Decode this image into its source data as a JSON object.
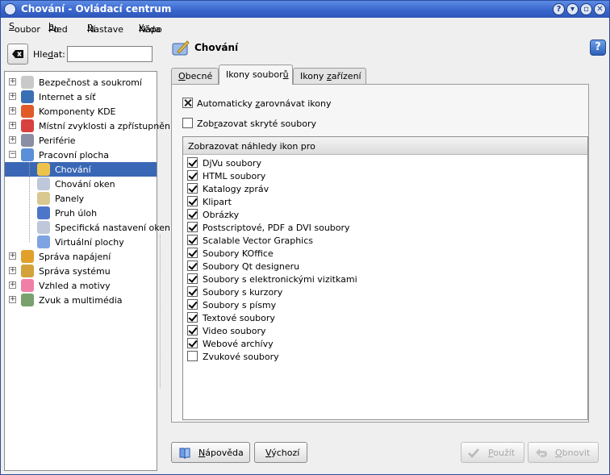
{
  "window": {
    "title": "Chování - Ovládací centrum"
  },
  "titlebar_buttons": [
    "?",
    "▾",
    "▫",
    "✕"
  ],
  "menu": [
    {
      "pre": "",
      "key": "S",
      "post": "oubor"
    },
    {
      "pre": "Po",
      "key": "h",
      "post": "led"
    },
    {
      "pre": "Nastave",
      "key": "n",
      "post": "í"
    },
    {
      "pre": "Nápo",
      "key": "v",
      "post": "ěda"
    }
  ],
  "search": {
    "label_pre": "Hle",
    "label_key": "d",
    "label_post": "at:",
    "value": "",
    "icon": "clear-search-icon"
  },
  "tree": [
    {
      "label": "Bezpečnost a soukromí",
      "icon": "security-icon",
      "color": "#c9c9c9",
      "expander": "+"
    },
    {
      "label": "Internet a síť",
      "icon": "globe-icon",
      "color": "#3a6fb6",
      "expander": "+"
    },
    {
      "label": "Komponenty KDE",
      "icon": "components-icon",
      "color": "#e05a2a",
      "expander": "+"
    },
    {
      "label": "Místní zvyklosti a zpřístupnění",
      "icon": "flag-icon",
      "color": "#d8413f",
      "expander": "+"
    },
    {
      "label": "Periférie",
      "icon": "mouse-icon",
      "color": "#8b8fa3",
      "expander": "+"
    },
    {
      "label": "Pracovní plocha",
      "icon": "desktop-icon",
      "color": "#5b8fd8",
      "expander": "−"
    },
    {
      "label": "Chování",
      "icon": "behavior-icon",
      "color": "#eec34b",
      "child": true,
      "selected": true
    },
    {
      "label": "Chování oken",
      "icon": "window-behavior-icon",
      "color": "#bfc8da",
      "child": true
    },
    {
      "label": "Panely",
      "icon": "panels-icon",
      "color": "#d9c890",
      "child": true
    },
    {
      "label": "Pruh úloh",
      "icon": "taskbar-icon",
      "color": "#4c77c9",
      "child": true
    },
    {
      "label": "Specifická nastavení oken",
      "icon": "window-specific-icon",
      "color": "#bfc8da",
      "child": true
    },
    {
      "label": "Virtuální plochy",
      "icon": "virtual-desktops-icon",
      "color": "#7da3e3",
      "child": true
    },
    {
      "label": "Správa napájení",
      "icon": "power-icon",
      "color": "#e0a02a",
      "expander": "+"
    },
    {
      "label": "Správa systému",
      "icon": "system-icon",
      "color": "#d4a23b",
      "expander": "+"
    },
    {
      "label": "Vzhled a motivy",
      "icon": "appearance-icon",
      "color": "#f07fa8",
      "expander": "+"
    },
    {
      "label": "Zvuk a multimédia",
      "icon": "sound-icon",
      "color": "#7aa06d",
      "expander": "+"
    }
  ],
  "page": {
    "title": "Chování",
    "help": "?"
  },
  "tabs": [
    {
      "pre": "",
      "key": "O",
      "post": "becné",
      "active": false
    },
    {
      "pre": "Ikony soubor",
      "key": "ů",
      "post": "",
      "active": true
    },
    {
      "pre": "Ikony ",
      "key": "z",
      "post": "ařízení",
      "active": false
    }
  ],
  "options": [
    {
      "pre": "Automaticky ",
      "key": "z",
      "post": "arovnávat ikony",
      "state": "x"
    },
    {
      "pre": "Zob",
      "key": "r",
      "post": "azovat skryté soubory",
      "state": "none"
    }
  ],
  "preview_list": {
    "header": "Zobrazovat náhledy ikon pro",
    "items": [
      {
        "label": "DjVu soubory",
        "checked": true
      },
      {
        "label": "HTML soubory",
        "checked": true
      },
      {
        "label": "Katalogy zpráv",
        "checked": true
      },
      {
        "label": "Klipart",
        "checked": true
      },
      {
        "label": "Obrázky",
        "checked": true
      },
      {
        "label": "Postscriptové, PDF a DVI soubory",
        "checked": true
      },
      {
        "label": "Scalable Vector Graphics",
        "checked": true
      },
      {
        "label": "Soubory KOffice",
        "checked": true
      },
      {
        "label": "Soubory Qt designeru",
        "checked": true
      },
      {
        "label": "Soubory s elektronickými vizitkami",
        "checked": true
      },
      {
        "label": "Soubory s kurzory",
        "checked": true
      },
      {
        "label": "Soubory s písmy",
        "checked": true
      },
      {
        "label": "Textové soubory",
        "checked": true
      },
      {
        "label": "Video soubory",
        "checked": true
      },
      {
        "label": "Webové archívy",
        "checked": true
      },
      {
        "label": "Zvukové soubory",
        "checked": false
      }
    ]
  },
  "buttons": {
    "help": {
      "pre": "",
      "key": "N",
      "post": "ápověda"
    },
    "defaults": {
      "pre": "",
      "key": "V",
      "post": "ýchozí"
    },
    "apply": {
      "pre": "",
      "key": "P",
      "post": "oužít"
    },
    "reset": {
      "pre": "",
      "key": "O",
      "post": "bnovit"
    }
  }
}
